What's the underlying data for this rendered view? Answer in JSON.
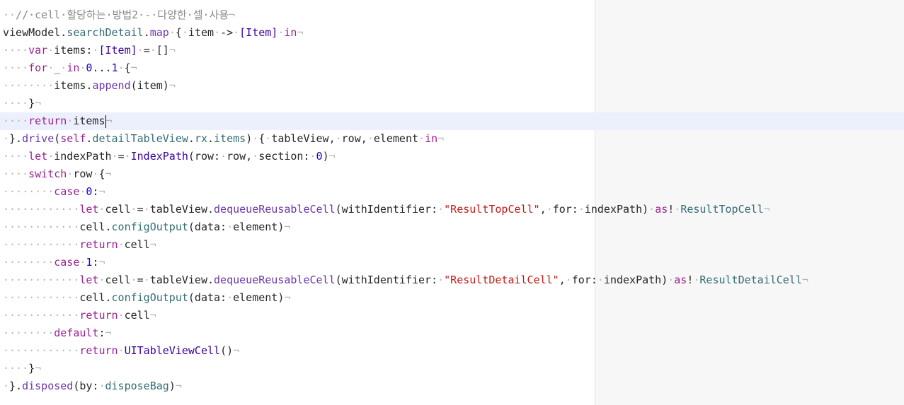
{
  "colors": {
    "keyword": "#9b2393",
    "function": "#6c36a9",
    "type": "#3900a0",
    "number": "#1c00cf",
    "string": "#c41a16",
    "comment": "#8a8a8a",
    "current_line": "#ecf0fc",
    "invisible": "#b4b4b4"
  },
  "editor": {
    "current_line_index": 6,
    "lines": [
      {
        "tokens": [
          {
            "t": "ws",
            "v": "··"
          },
          {
            "t": "cm",
            "v": "//·cell·"
          },
          {
            "t": "cm",
            "v": "할당하는·방법2·-·다양한·셀·사용"
          },
          {
            "t": "ws",
            "v": "¬"
          }
        ]
      },
      {
        "tokens": [
          {
            "t": "pl",
            "v": "viewModel."
          },
          {
            "t": "prop",
            "v": "searchDetail"
          },
          {
            "t": "pl",
            "v": "."
          },
          {
            "t": "fn",
            "v": "map"
          },
          {
            "t": "ws",
            "v": "·"
          },
          {
            "t": "pl",
            "v": "{"
          },
          {
            "t": "ws",
            "v": "·"
          },
          {
            "t": "pl",
            "v": "item"
          },
          {
            "t": "ws",
            "v": "·"
          },
          {
            "t": "pl",
            "v": "->"
          },
          {
            "t": "ws",
            "v": "·"
          },
          {
            "t": "ty",
            "v": "[Item]"
          },
          {
            "t": "ws",
            "v": "·"
          },
          {
            "t": "kw",
            "v": "in"
          },
          {
            "t": "ws",
            "v": "¬"
          }
        ]
      },
      {
        "tokens": [
          {
            "t": "ws",
            "v": "····"
          },
          {
            "t": "kw",
            "v": "var"
          },
          {
            "t": "ws",
            "v": "·"
          },
          {
            "t": "pl",
            "v": "items:"
          },
          {
            "t": "ws",
            "v": "·"
          },
          {
            "t": "ty",
            "v": "[Item]"
          },
          {
            "t": "ws",
            "v": "·"
          },
          {
            "t": "pl",
            "v": "="
          },
          {
            "t": "ws",
            "v": "·"
          },
          {
            "t": "pl",
            "v": "[]"
          },
          {
            "t": "ws",
            "v": "¬"
          }
        ]
      },
      {
        "tokens": [
          {
            "t": "ws",
            "v": "····"
          },
          {
            "t": "kw",
            "v": "for"
          },
          {
            "t": "ws",
            "v": "·"
          },
          {
            "t": "kw",
            "v": "_"
          },
          {
            "t": "ws",
            "v": "·"
          },
          {
            "t": "kw",
            "v": "in"
          },
          {
            "t": "ws",
            "v": "·"
          },
          {
            "t": "num",
            "v": "0"
          },
          {
            "t": "pl",
            "v": "..."
          },
          {
            "t": "num",
            "v": "1"
          },
          {
            "t": "ws",
            "v": "·"
          },
          {
            "t": "pl",
            "v": "{"
          },
          {
            "t": "ws",
            "v": "¬"
          }
        ]
      },
      {
        "tokens": [
          {
            "t": "ws",
            "v": "········"
          },
          {
            "t": "pl",
            "v": "items."
          },
          {
            "t": "fn",
            "v": "append"
          },
          {
            "t": "pl",
            "v": "(item)"
          },
          {
            "t": "ws",
            "v": "¬"
          }
        ]
      },
      {
        "tokens": [
          {
            "t": "ws",
            "v": "····"
          },
          {
            "t": "pl",
            "v": "}"
          },
          {
            "t": "ws",
            "v": "¬"
          }
        ]
      },
      {
        "tokens": [
          {
            "t": "ws",
            "v": "····"
          },
          {
            "t": "kw",
            "v": "return"
          },
          {
            "t": "ws",
            "v": "·"
          },
          {
            "t": "pl",
            "v": "items"
          },
          {
            "t": "caret",
            "v": ""
          },
          {
            "t": "ws",
            "v": "¬"
          }
        ]
      },
      {
        "tokens": [
          {
            "t": "ws",
            "v": "·"
          },
          {
            "t": "pl",
            "v": "}."
          },
          {
            "t": "fn",
            "v": "drive"
          },
          {
            "t": "pl",
            "v": "("
          },
          {
            "t": "kw",
            "v": "self"
          },
          {
            "t": "pl",
            "v": "."
          },
          {
            "t": "prop",
            "v": "detailTableView"
          },
          {
            "t": "pl",
            "v": "."
          },
          {
            "t": "prop",
            "v": "rx"
          },
          {
            "t": "pl",
            "v": "."
          },
          {
            "t": "prop",
            "v": "items"
          },
          {
            "t": "pl",
            "v": ")"
          },
          {
            "t": "ws",
            "v": "·"
          },
          {
            "t": "pl",
            "v": "{"
          },
          {
            "t": "ws",
            "v": "·"
          },
          {
            "t": "pl",
            "v": "tableView,"
          },
          {
            "t": "ws",
            "v": "·"
          },
          {
            "t": "pl",
            "v": "row,"
          },
          {
            "t": "ws",
            "v": "·"
          },
          {
            "t": "pl",
            "v": "element"
          },
          {
            "t": "ws",
            "v": "·"
          },
          {
            "t": "kw",
            "v": "in"
          },
          {
            "t": "ws",
            "v": "¬"
          }
        ]
      },
      {
        "tokens": [
          {
            "t": "ws",
            "v": "····"
          },
          {
            "t": "kw",
            "v": "let"
          },
          {
            "t": "ws",
            "v": "·"
          },
          {
            "t": "pl",
            "v": "indexPath"
          },
          {
            "t": "ws",
            "v": "·"
          },
          {
            "t": "pl",
            "v": "="
          },
          {
            "t": "ws",
            "v": "·"
          },
          {
            "t": "ty",
            "v": "IndexPath"
          },
          {
            "t": "pl",
            "v": "(row:"
          },
          {
            "t": "ws",
            "v": "·"
          },
          {
            "t": "pl",
            "v": "row,"
          },
          {
            "t": "ws",
            "v": "·"
          },
          {
            "t": "pl",
            "v": "section:"
          },
          {
            "t": "ws",
            "v": "·"
          },
          {
            "t": "num",
            "v": "0"
          },
          {
            "t": "pl",
            "v": ")"
          },
          {
            "t": "ws",
            "v": "¬"
          }
        ]
      },
      {
        "tokens": [
          {
            "t": "ws",
            "v": "····"
          },
          {
            "t": "kw",
            "v": "switch"
          },
          {
            "t": "ws",
            "v": "·"
          },
          {
            "t": "pl",
            "v": "row"
          },
          {
            "t": "ws",
            "v": "·"
          },
          {
            "t": "pl",
            "v": "{"
          },
          {
            "t": "ws",
            "v": "¬"
          }
        ]
      },
      {
        "tokens": [
          {
            "t": "ws",
            "v": "········"
          },
          {
            "t": "kw",
            "v": "case"
          },
          {
            "t": "ws",
            "v": "·"
          },
          {
            "t": "num",
            "v": "0"
          },
          {
            "t": "pl",
            "v": ":"
          },
          {
            "t": "ws",
            "v": "¬"
          }
        ]
      },
      {
        "tokens": [
          {
            "t": "ws",
            "v": "············"
          },
          {
            "t": "kw",
            "v": "let"
          },
          {
            "t": "ws",
            "v": "·"
          },
          {
            "t": "pl",
            "v": "cell"
          },
          {
            "t": "ws",
            "v": "·"
          },
          {
            "t": "pl",
            "v": "="
          },
          {
            "t": "ws",
            "v": "·"
          },
          {
            "t": "pl",
            "v": "tableView."
          },
          {
            "t": "fn",
            "v": "dequeueReusableCell"
          },
          {
            "t": "pl",
            "v": "(withIdentifier:"
          },
          {
            "t": "ws",
            "v": "·"
          },
          {
            "t": "str",
            "v": "\"ResultTopCell\""
          },
          {
            "t": "pl",
            "v": ","
          },
          {
            "t": "ws",
            "v": "·"
          },
          {
            "t": "pl",
            "v": "for:"
          },
          {
            "t": "ws",
            "v": "·"
          },
          {
            "t": "pl",
            "v": "indexPath)"
          },
          {
            "t": "ws",
            "v": "·"
          },
          {
            "t": "kw",
            "v": "as"
          },
          {
            "t": "pl",
            "v": "!"
          },
          {
            "t": "ws",
            "v": "·"
          },
          {
            "t": "prop",
            "v": "ResultTopCell"
          },
          {
            "t": "ws",
            "v": "¬"
          }
        ]
      },
      {
        "tokens": [
          {
            "t": "ws",
            "v": "············"
          },
          {
            "t": "pl",
            "v": "cell."
          },
          {
            "t": "prop",
            "v": "configOutput"
          },
          {
            "t": "pl",
            "v": "(data:"
          },
          {
            "t": "ws",
            "v": "·"
          },
          {
            "t": "pl",
            "v": "element)"
          },
          {
            "t": "ws",
            "v": "¬"
          }
        ]
      },
      {
        "tokens": [
          {
            "t": "ws",
            "v": "············"
          },
          {
            "t": "kw",
            "v": "return"
          },
          {
            "t": "ws",
            "v": "·"
          },
          {
            "t": "pl",
            "v": "cell"
          },
          {
            "t": "ws",
            "v": "¬"
          }
        ]
      },
      {
        "tokens": [
          {
            "t": "ws",
            "v": "········"
          },
          {
            "t": "kw",
            "v": "case"
          },
          {
            "t": "ws",
            "v": "·"
          },
          {
            "t": "num",
            "v": "1"
          },
          {
            "t": "pl",
            "v": ":"
          },
          {
            "t": "ws",
            "v": "¬"
          }
        ]
      },
      {
        "tokens": [
          {
            "t": "ws",
            "v": "············"
          },
          {
            "t": "kw",
            "v": "let"
          },
          {
            "t": "ws",
            "v": "·"
          },
          {
            "t": "pl",
            "v": "cell"
          },
          {
            "t": "ws",
            "v": "·"
          },
          {
            "t": "pl",
            "v": "="
          },
          {
            "t": "ws",
            "v": "·"
          },
          {
            "t": "pl",
            "v": "tableView."
          },
          {
            "t": "fn",
            "v": "dequeueReusableCell"
          },
          {
            "t": "pl",
            "v": "(withIdentifier:"
          },
          {
            "t": "ws",
            "v": "·"
          },
          {
            "t": "str",
            "v": "\"ResultDetailCell\""
          },
          {
            "t": "pl",
            "v": ","
          },
          {
            "t": "ws",
            "v": "·"
          },
          {
            "t": "pl",
            "v": "for:"
          },
          {
            "t": "ws",
            "v": "·"
          },
          {
            "t": "pl",
            "v": "indexPath)"
          },
          {
            "t": "ws",
            "v": "·"
          },
          {
            "t": "kw",
            "v": "as"
          },
          {
            "t": "pl",
            "v": "!"
          },
          {
            "t": "ws",
            "v": "·"
          },
          {
            "t": "prop",
            "v": "ResultDetailCell"
          },
          {
            "t": "ws",
            "v": "¬"
          }
        ]
      },
      {
        "tokens": [
          {
            "t": "ws",
            "v": "············"
          },
          {
            "t": "pl",
            "v": "cell."
          },
          {
            "t": "prop",
            "v": "configOutput"
          },
          {
            "t": "pl",
            "v": "(data:"
          },
          {
            "t": "ws",
            "v": "·"
          },
          {
            "t": "pl",
            "v": "element)"
          },
          {
            "t": "ws",
            "v": "¬"
          }
        ]
      },
      {
        "tokens": [
          {
            "t": "ws",
            "v": "············"
          },
          {
            "t": "kw",
            "v": "return"
          },
          {
            "t": "ws",
            "v": "·"
          },
          {
            "t": "pl",
            "v": "cell"
          },
          {
            "t": "ws",
            "v": "¬"
          }
        ]
      },
      {
        "tokens": [
          {
            "t": "ws",
            "v": "········"
          },
          {
            "t": "kw",
            "v": "default"
          },
          {
            "t": "pl",
            "v": ":"
          },
          {
            "t": "ws",
            "v": "¬"
          }
        ]
      },
      {
        "tokens": [
          {
            "t": "ws",
            "v": "············"
          },
          {
            "t": "kw",
            "v": "return"
          },
          {
            "t": "ws",
            "v": "·"
          },
          {
            "t": "ty",
            "v": "UITableViewCell"
          },
          {
            "t": "pl",
            "v": "()"
          },
          {
            "t": "ws",
            "v": "¬"
          }
        ]
      },
      {
        "tokens": [
          {
            "t": "ws",
            "v": "····"
          },
          {
            "t": "pl",
            "v": "}"
          },
          {
            "t": "ws",
            "v": "¬"
          }
        ]
      },
      {
        "tokens": [
          {
            "t": "ws",
            "v": "·"
          },
          {
            "t": "pl",
            "v": "}."
          },
          {
            "t": "fn",
            "v": "disposed"
          },
          {
            "t": "pl",
            "v": "(by:"
          },
          {
            "t": "ws",
            "v": "·"
          },
          {
            "t": "prop",
            "v": "disposeBag"
          },
          {
            "t": "pl",
            "v": ")"
          },
          {
            "t": "ws",
            "v": "¬"
          }
        ]
      }
    ]
  }
}
